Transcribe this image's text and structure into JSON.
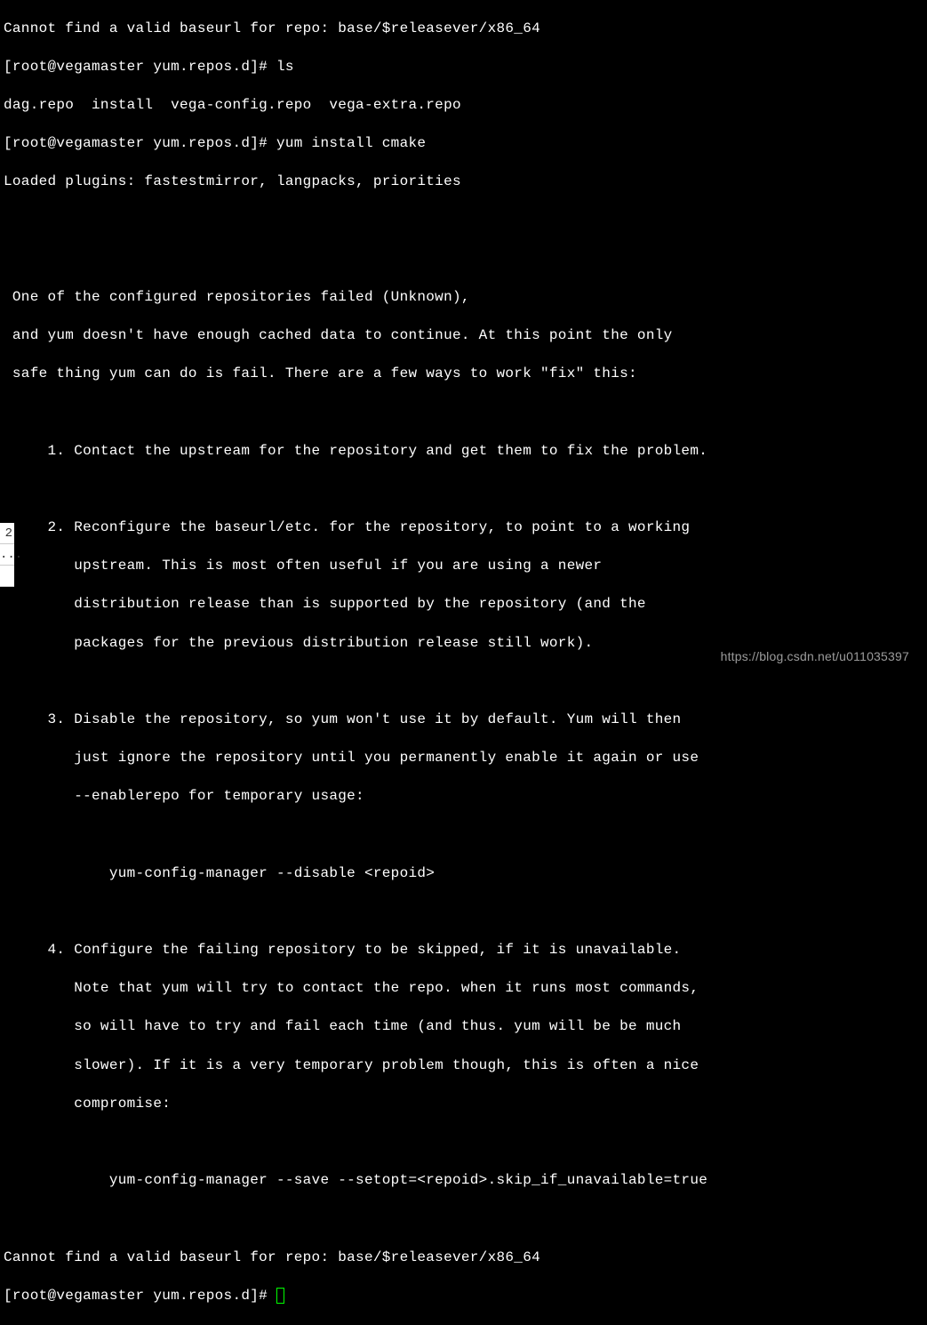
{
  "terminal": {
    "lines": [
      "Cannot find a valid baseurl for repo: base/$releasever/x86_64",
      "[root@vegamaster yum.repos.d]# ls",
      "dag.repo  install  vega-config.repo  vega-extra.repo",
      "[root@vegamaster yum.repos.d]# yum install cmake",
      "Loaded plugins: fastestmirror, langpacks, priorities",
      "",
      "",
      " One of the configured repositories failed (Unknown),",
      " and yum doesn't have enough cached data to continue. At this point the only",
      " safe thing yum can do is fail. There are a few ways to work \"fix\" this:",
      "",
      "     1. Contact the upstream for the repository and get them to fix the problem.",
      "",
      "     2. Reconfigure the baseurl/etc. for the repository, to point to a working",
      "        upstream. This is most often useful if you are using a newer",
      "        distribution release than is supported by the repository (and the",
      "        packages for the previous distribution release still work).",
      "",
      "     3. Disable the repository, so yum won't use it by default. Yum will then",
      "        just ignore the repository until you permanently enable it again or use",
      "        --enablerepo for temporary usage:",
      "",
      "            yum-config-manager --disable <repoid>",
      "",
      "     4. Configure the failing repository to be skipped, if it is unavailable.",
      "        Note that yum will try to contact the repo. when it runs most commands,",
      "        so will have to try and fail each time (and thus. yum will be be much",
      "        slower). If it is a very temporary problem though, this is often a nice",
      "        compromise:",
      "",
      "            yum-config-manager --save --setopt=<repoid>.skip_if_unavailable=true",
      "",
      "Cannot find a valid baseurl for repo: base/$releasever/x86_64"
    ],
    "prompt": "[root@vegamaster yum.repos.d]# "
  },
  "watermark": "https://blog.csdn.net/u011035397",
  "left_fragments": {
    "frag1": "2",
    "frag2": "..."
  }
}
